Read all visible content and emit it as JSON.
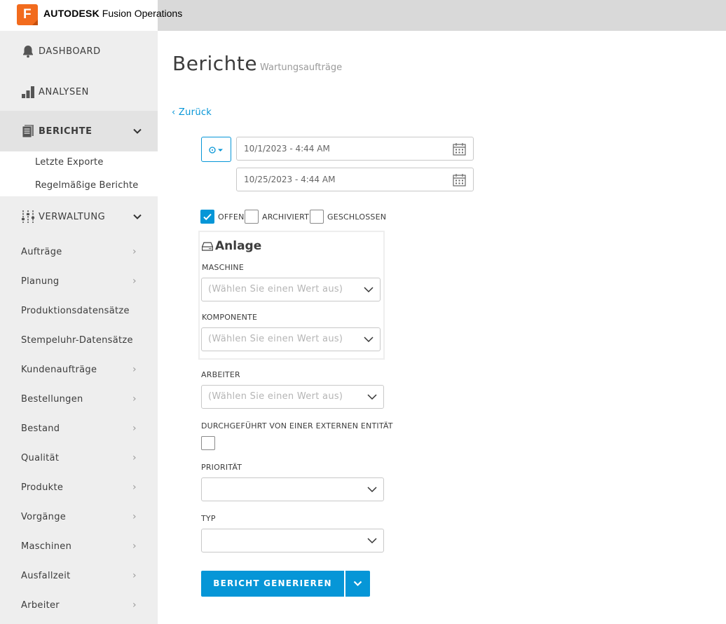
{
  "app": {
    "brand_bold": "AUTODESK",
    "brand_rest": " Fusion Operations",
    "logo_letter": "F"
  },
  "sidebar": {
    "top_items": [
      {
        "label": "DASHBOARD",
        "icon": "bell-icon"
      },
      {
        "label": "ANALYSEN",
        "icon": "bar-chart-icon"
      },
      {
        "label": "BERICHTE",
        "icon": "report-icon",
        "active": true
      },
      {
        "label": "VERWALTUNG",
        "icon": "sliders-icon"
      }
    ],
    "sub_items": [
      "Letzte Exporte",
      "Regelmäßige Berichte"
    ],
    "menu_items": [
      {
        "label": "Aufträge",
        "has_chevron": true
      },
      {
        "label": "Planung",
        "has_chevron": true
      },
      {
        "label": "Produktionsdatensätze",
        "has_chevron": false
      },
      {
        "label": "Stempeluhr-Datensätze",
        "has_chevron": false
      },
      {
        "label": "Kundenaufträge",
        "has_chevron": true
      },
      {
        "label": "Bestellungen",
        "has_chevron": true
      },
      {
        "label": "Bestand",
        "has_chevron": true
      },
      {
        "label": "Qualität",
        "has_chevron": true
      },
      {
        "label": "Produkte",
        "has_chevron": true
      },
      {
        "label": "Vorgänge",
        "has_chevron": true
      },
      {
        "label": "Maschinen",
        "has_chevron": true
      },
      {
        "label": "Ausfallzeit",
        "has_chevron": true
      },
      {
        "label": "Arbeiter",
        "has_chevron": true
      }
    ]
  },
  "main": {
    "title": "Berichte",
    "subtitle": "Wartungsaufträge",
    "back_label": "‹ Zurück",
    "date_from": "10/1/2023 - 4:44 AM",
    "date_to": "10/25/2023 - 4:44 AM",
    "status_filters": [
      {
        "label": "OFFEN",
        "checked": true
      },
      {
        "label": "ARCHIVIERT",
        "checked": false
      },
      {
        "label": "GESCHLOSSEN",
        "checked": false
      }
    ],
    "anlage": {
      "title": "Anlage",
      "machine_label": "MASCHINE",
      "machine_placeholder": "(Wählen Sie einen Wert aus)",
      "component_label": "KOMPONENTE",
      "component_placeholder": "(Wählen Sie einen Wert aus)"
    },
    "worker_label": "ARBEITER",
    "worker_placeholder": "(Wählen Sie einen Wert aus)",
    "external_label": "DURCHGEFÜHRT VON EINER EXTERNEN ENTITÄT",
    "external_checked": false,
    "priority_label": "PRIORITÄT",
    "priority_value": "",
    "type_label": "TYP",
    "type_value": "",
    "generate_label": "BERICHT GENERIEREN"
  },
  "colors": {
    "accent": "#0696d7",
    "brand_orange": "#f26b1d",
    "sidebar_bg": "#eeeeee"
  }
}
